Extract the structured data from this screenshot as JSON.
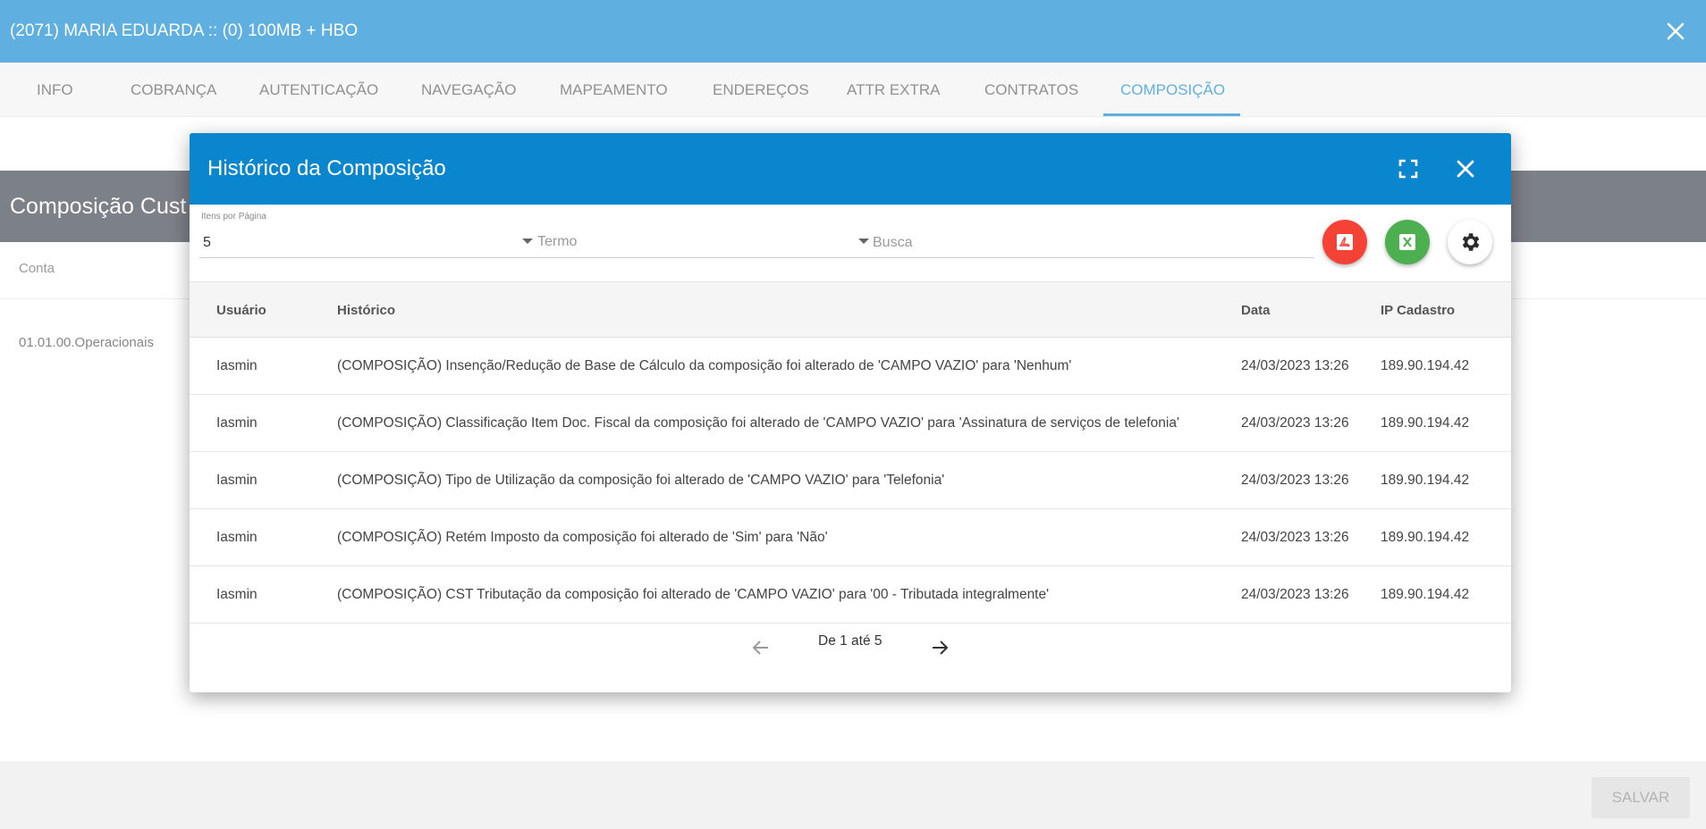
{
  "header": {
    "title": "(2071) MARIA EDUARDA :: (0) 100MB + HBO",
    "close_icon": "close-icon"
  },
  "tabs": [
    {
      "label": "INFO"
    },
    {
      "label": "COBRANÇA"
    },
    {
      "label": "AUTENTICAÇÃO"
    },
    {
      "label": "NAVEGAÇÃO"
    },
    {
      "label": "MAPEAMENTO"
    },
    {
      "label": "ENDEREÇOS"
    },
    {
      "label": "ATTR EXTRA"
    },
    {
      "label": "CONTRATOS"
    },
    {
      "label": "COMPOSIÇÃO",
      "active": true
    }
  ],
  "background": {
    "section_title": "Composição Cust",
    "column_label": "Conta",
    "cell_value": "01.01.00.Operacionais"
  },
  "footer": {
    "save_label": "SALVAR"
  },
  "modal": {
    "title": "Histórico da Composição",
    "fullscreen_icon": "fullscreen-icon",
    "close_icon": "close-icon",
    "filters": {
      "items_per_page_label": "Itens por Página",
      "items_per_page_value": "5",
      "term_placeholder": "Termo",
      "search_placeholder": "Busca"
    },
    "actions": [
      {
        "icon": "pdf-icon",
        "color": "#f44336"
      },
      {
        "icon": "excel-icon",
        "color": "#4caf50"
      },
      {
        "icon": "gear-icon",
        "color": "#ffffff"
      }
    ],
    "table": {
      "columns": [
        "Usuário",
        "Histórico",
        "Data",
        "IP Cadastro"
      ],
      "rows": [
        {
          "usuario": "Iasmin",
          "historico": "(COMPOSIÇÃO) Insenção/Redução de Base de Cálculo da composição foi alterado de 'CAMPO VAZIO' para 'Nenhum'",
          "data": "24/03/2023 13:26",
          "ip": "189.90.194.42"
        },
        {
          "usuario": "Iasmin",
          "historico": "(COMPOSIÇÃO) Classificação Item Doc. Fiscal da composição foi alterado de 'CAMPO VAZIO' para 'Assinatura de serviços de telefonia'",
          "data": "24/03/2023 13:26",
          "ip": "189.90.194.42"
        },
        {
          "usuario": "Iasmin",
          "historico": "(COMPOSIÇÃO) Tipo de Utilização da composição foi alterado de 'CAMPO VAZIO' para 'Telefonia'",
          "data": "24/03/2023 13:26",
          "ip": "189.90.194.42"
        },
        {
          "usuario": "Iasmin",
          "historico": "(COMPOSIÇÃO) Retém Imposto da composição foi alterado de 'Sim' para 'Não'",
          "data": "24/03/2023 13:26",
          "ip": "189.90.194.42"
        },
        {
          "usuario": "Iasmin",
          "historico": "(COMPOSIÇÃO) CST Tributação da composição foi alterado de 'CAMPO VAZIO' para '00 - Tributada integralmente'",
          "data": "24/03/2023 13:26",
          "ip": "189.90.194.42"
        }
      ]
    },
    "pagination": {
      "text": "De 1 até 5"
    }
  },
  "colors": {
    "primary": "#0a86cf",
    "section_header": "#363c48",
    "pdf": "#f44336",
    "excel": "#4caf50"
  }
}
